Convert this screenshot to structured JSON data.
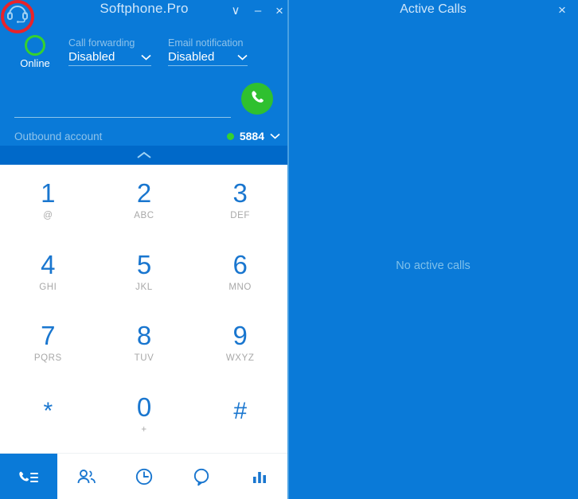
{
  "window": {
    "title": "Softphone.Pro",
    "controls": {
      "chevron": "∨",
      "minimize": "–",
      "close": "×"
    }
  },
  "header": {
    "logo_icon": "headset-icon",
    "status": {
      "label": "Online",
      "color": "#35d12f"
    },
    "fields": [
      {
        "label": "Call forwarding",
        "value": "Disabled"
      },
      {
        "label": "Email notification",
        "value": "Disabled"
      }
    ]
  },
  "dialer": {
    "number_placeholder": "",
    "number_value": "",
    "call_button_icon": "phone-icon",
    "call_button_color": "#2fc02f",
    "outbound": {
      "label": "Outbound account",
      "account": "5884",
      "status_color": "#35d12f",
      "caret": "∨"
    },
    "collapse_icon": "chevron-up-icon"
  },
  "keypad": [
    {
      "digit": "1",
      "sub": "@"
    },
    {
      "digit": "2",
      "sub": "ABC"
    },
    {
      "digit": "3",
      "sub": "DEF"
    },
    {
      "digit": "4",
      "sub": "GHI"
    },
    {
      "digit": "5",
      "sub": "JKL"
    },
    {
      "digit": "6",
      "sub": "MNO"
    },
    {
      "digit": "7",
      "sub": "PQRS"
    },
    {
      "digit": "8",
      "sub": "TUV"
    },
    {
      "digit": "9",
      "sub": "WXYZ"
    },
    {
      "digit": "*",
      "sub": ""
    },
    {
      "digit": "0",
      "sub": "+"
    },
    {
      "digit": "#",
      "sub": ""
    }
  ],
  "nav": [
    {
      "name": "dialpad",
      "icon": "phone-keypad-icon",
      "active": true
    },
    {
      "name": "contacts",
      "icon": "contacts-icon",
      "active": false
    },
    {
      "name": "history",
      "icon": "clock-icon",
      "active": false
    },
    {
      "name": "chat",
      "icon": "chat-bubble-icon",
      "active": false
    },
    {
      "name": "statistics",
      "icon": "bar-chart-icon",
      "active": false
    }
  ],
  "right_panel": {
    "title": "Active Calls",
    "empty_text": "No active calls",
    "close": "×"
  },
  "theme": {
    "panel_blue": "#0a7ad8",
    "collapse_blue": "#0069c9",
    "accent_blue": "#1976cf",
    "muted_blue": "#8fc3ea",
    "annotation_red": "#e8232a"
  }
}
